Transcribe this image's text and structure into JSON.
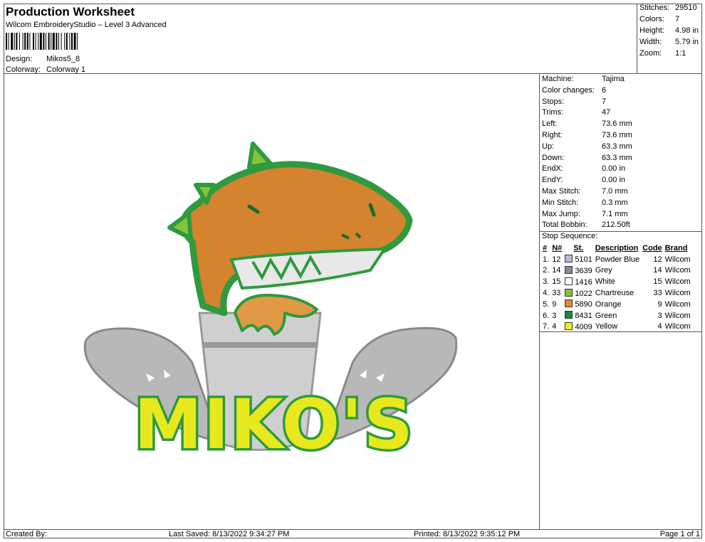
{
  "header": {
    "title": "Production Worksheet",
    "subtitle": "Wilcom EmbroideryStudio – Level 3 Advanced",
    "design_label": "Design:",
    "design_value": "Mikos5_8",
    "colorway_label": "Colorway:",
    "colorway_value": "Colorway 1"
  },
  "summary": [
    {
      "label": "Stitches:",
      "value": "29510"
    },
    {
      "label": "Colors:",
      "value": "7"
    },
    {
      "label": "Height:",
      "value": "4.98 in"
    },
    {
      "label": "Width:",
      "value": "5.79 in"
    },
    {
      "label": "Zoom:",
      "value": "1:1"
    }
  ],
  "specs": [
    {
      "label": "Machine:",
      "value": "Tajima"
    },
    {
      "label": "Color changes:",
      "value": "6"
    },
    {
      "label": "Stops:",
      "value": "7"
    },
    {
      "label": "Trims:",
      "value": "47"
    },
    {
      "label": "Left:",
      "value": "73.6 mm"
    },
    {
      "label": "Right:",
      "value": "73.6 mm"
    },
    {
      "label": "Up:",
      "value": "63.3 mm"
    },
    {
      "label": "Down:",
      "value": "63.3 mm"
    },
    {
      "label": "EndX:",
      "value": "0.00 in"
    },
    {
      "label": "EndY:",
      "value": "0.00 in"
    },
    {
      "label": "Max Stitch:",
      "value": "7.0 mm"
    },
    {
      "label": "Min Stitch:",
      "value": "0.3 mm"
    },
    {
      "label": "Max Jump:",
      "value": "7.1 mm"
    },
    {
      "label": "Total Bobbin:",
      "value": "212.50ft"
    }
  ],
  "stop_sequence": {
    "title": "Stop Sequence:",
    "headers": [
      "#",
      "N#",
      "St.",
      "Description",
      "Code",
      "Brand"
    ],
    "rows": [
      {
        "n": "1.",
        "needle": "12",
        "color": "#b6bcd8",
        "st": "5101",
        "desc": "Powder Blue",
        "code": "12",
        "brand": "Wilcom"
      },
      {
        "n": "2.",
        "needle": "14",
        "color": "#8c8c8c",
        "st": "3639",
        "desc": "Grey",
        "code": "14",
        "brand": "Wilcom"
      },
      {
        "n": "3.",
        "needle": "15",
        "color": "#ffffff",
        "st": "1416",
        "desc": "White",
        "code": "15",
        "brand": "Wilcom"
      },
      {
        "n": "4.",
        "needle": "33",
        "color": "#86c23a",
        "st": "1022",
        "desc": "Chartreuse",
        "code": "33",
        "brand": "Wilcom"
      },
      {
        "n": "5.",
        "needle": "9",
        "color": "#e08a2c",
        "st": "5890",
        "desc": "Orange",
        "code": "9",
        "brand": "Wilcom"
      },
      {
        "n": "6.",
        "needle": "3",
        "color": "#138a3e",
        "st": "8431",
        "desc": "Green",
        "code": "3",
        "brand": "Wilcom"
      },
      {
        "n": "7.",
        "needle": "4",
        "color": "#f2ee18",
        "st": "4009",
        "desc": "Yellow",
        "code": "4",
        "brand": "Wilcom"
      }
    ]
  },
  "footer": {
    "created_by": "Created By:",
    "last_saved": "Last Saved: 8/13/2022 9:34:27 PM",
    "printed": "Printed: 8/13/2022 9:35:12 PM",
    "page": "Page 1 of 1"
  },
  "design_art": {
    "logo_text": "MIKO'S",
    "colors": {
      "green": "#2f9a3e",
      "orange": "#d4832f",
      "yellow": "#e8e81e",
      "grey": "#9a9a9a",
      "lightgrey": "#cfcfcf"
    }
  }
}
